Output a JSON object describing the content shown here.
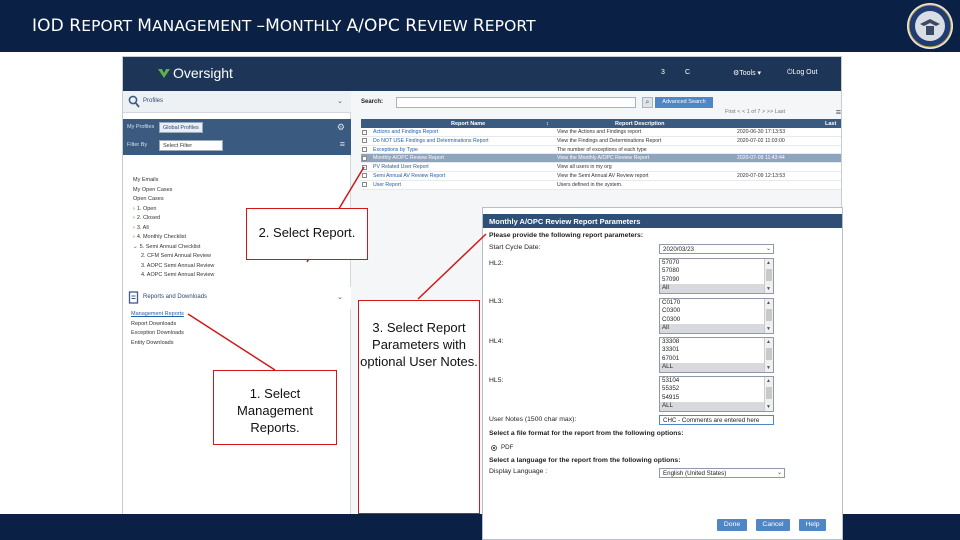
{
  "slide": {
    "title_parts": [
      "IOD R",
      "EPORT ",
      "M",
      "ANAGEMENT ",
      "–M",
      "ONTHLY ",
      "A/OPC R",
      "EVIEW ",
      "R",
      "EPORT"
    ],
    "header_color": "#0a2145",
    "seal_icon": "dod-seal-icon"
  },
  "app": {
    "logo_text": "Oversight",
    "nav": {
      "item_3": "3",
      "item_c": "C",
      "tools": "⚙Tools ▾",
      "logout": "⏻Log Out"
    },
    "sidebar": {
      "profiles_label": "Profiles",
      "my_profiles_key": "My Profiles",
      "my_profiles_value": "Global Profiles",
      "filter_by_key": "Filter By",
      "filter_by_value": "Select Filter",
      "items": [
        {
          "label": "My Emails",
          "level": 1
        },
        {
          "label": "My Open Cases",
          "level": 1
        },
        {
          "label": "Open Cases",
          "level": 1
        },
        {
          "label": "1. Open",
          "level": 1,
          "caret": "›"
        },
        {
          "label": "2. Closed",
          "level": 1,
          "caret": "›"
        },
        {
          "label": "3. All",
          "level": 1,
          "caret": "›"
        },
        {
          "label": "4. Monthly Checklist",
          "level": 1,
          "caret": "›"
        },
        {
          "label": "5. Semi Annual Checklist",
          "level": 1,
          "caret": "⌄"
        },
        {
          "label": "2. CFM Semi Annual Review",
          "level": 2
        },
        {
          "label": "3. AOPC Semi Annual Review",
          "level": 2
        },
        {
          "label": "4. AOPC Semi Annual Review",
          "level": 2
        }
      ],
      "reports_label": "Reports and Downloads",
      "links": [
        "Management Reports",
        "Report Downloads",
        "Exception Downloads",
        "Entity Downloads"
      ]
    },
    "main": {
      "search_label": "Search:",
      "search_value": "",
      "advanced_search_label": "Advanced Search",
      "pager": "First  <  <  1  of 7  >  >>  Last",
      "columns": [
        "Report Name",
        "Report Description",
        "Last"
      ],
      "rows": [
        {
          "name": "Actions and Findings Report",
          "desc": "View the Actions and Findings report",
          "date": "2020-06-30 17:13:53",
          "selected": false
        },
        {
          "name": "Do NOT USE Findings and Determinations Report",
          "desc": "View the Findings and Determinations Report",
          "date": "2020-07-02 11:03:00",
          "selected": false
        },
        {
          "name": "Exceptions by Type",
          "desc": "The number of exceptions of each type",
          "date": "",
          "selected": false
        },
        {
          "name": "Monthly A/OPC Review Report",
          "desc": "View the Monthly A/OPC Review Report",
          "date": "2020-07-09 11:43:44",
          "selected": true
        },
        {
          "name": "PV Related User Report",
          "desc": "View all users in my org",
          "date": "",
          "selected": false
        },
        {
          "name": "Semi Annual AV Review Report",
          "desc": "View the Semi Annual AV Review report",
          "date": "2020-07-09 12:13:53",
          "selected": false
        },
        {
          "name": "User Report",
          "desc": "Users defined in the system.",
          "date": "",
          "selected": false
        }
      ]
    }
  },
  "dialog": {
    "title": "Monthly A/OPC Review Report Parameters",
    "intro": "Please provide the following report parameters:",
    "start_cycle_label": "Start Cycle Date:",
    "start_cycle_value": "2020/03/23",
    "hl2_label": "HL2:",
    "hl2_options": [
      "57070",
      "57080",
      "57090",
      "All"
    ],
    "hl3_label": "HL3:",
    "hl3_options": [
      "C0170",
      "C0300",
      "C0300",
      "All"
    ],
    "hl4_label": "HL4:",
    "hl4_options": [
      "33308",
      "33301",
      "67001",
      "ALL"
    ],
    "hl5_label": "HL5:",
    "hl5_options": [
      "53104",
      "55352",
      "54915",
      "ALL"
    ],
    "user_notes_label": "User Notes (1500 char max):",
    "user_notes_value": "CHC - Comments are entered here",
    "file_format_heading": "Select a file format for the report from the following options:",
    "file_format_option": "PDF",
    "language_heading": "Select a language for the report from the following options:",
    "display_language_label": "Display Language :",
    "display_language_value": "English (United States)",
    "buttons": {
      "done": "Done",
      "cancel": "Cancel",
      "help": "Help"
    }
  },
  "callouts": {
    "step1": "1. Select Management Reports.",
    "step2": "2. Select Report.",
    "step3": "3. Select Report Parameters with optional User Notes."
  },
  "colors": {
    "accent": "#4f86c6",
    "callout_border": "#d01818",
    "app_bar": "#1d3556"
  }
}
